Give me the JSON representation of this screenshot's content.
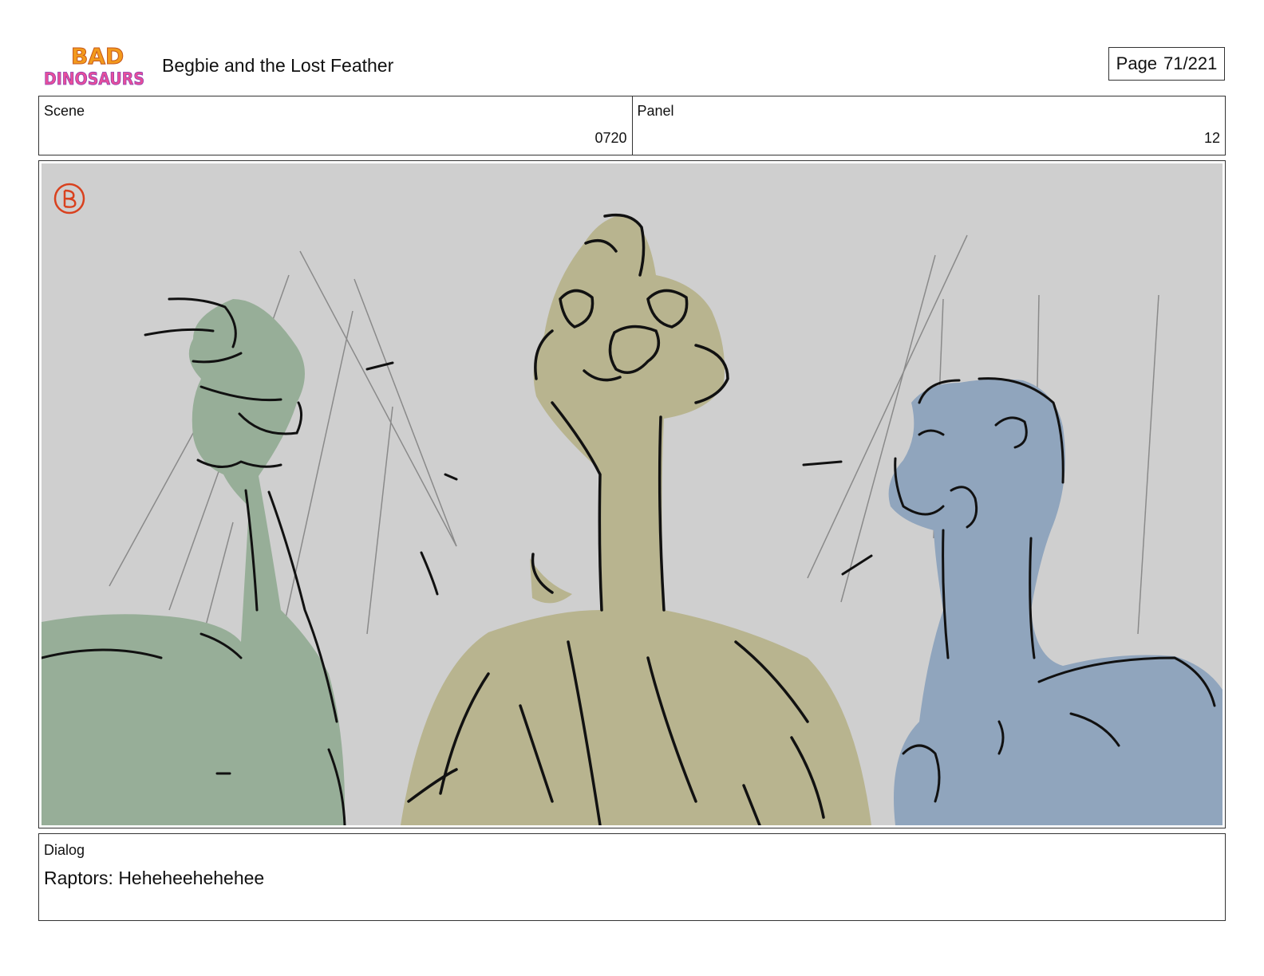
{
  "header": {
    "logo_text_line1": "BAD",
    "logo_text_line2": "DINOSAURS",
    "title": "Begbie and the Lost Feather",
    "page_label": "Page",
    "page_value": "71/221"
  },
  "meta": {
    "scene_label": "Scene",
    "scene_value": "0720",
    "panel_label": "Panel",
    "panel_value": "12"
  },
  "panel_image": {
    "icon": "b-mark-icon",
    "colors": {
      "background": "#cfcfcf",
      "left_raptor": "#97ae98",
      "center_raptor": "#b8b48f",
      "right_raptor": "#90a5bd",
      "b_mark": "#d9411e"
    }
  },
  "dialog": {
    "label": "Dialog",
    "text": "Raptors: Heheheehehehee"
  }
}
